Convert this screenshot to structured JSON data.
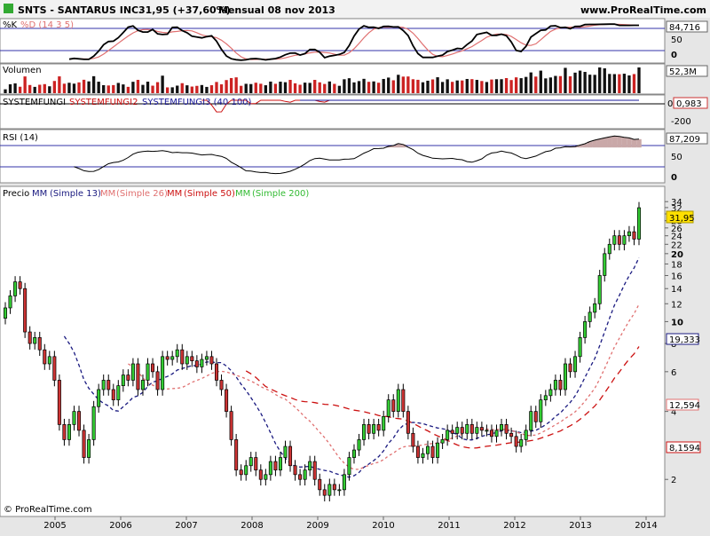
{
  "header": {
    "title": "SNTS - SANTARUS INC.",
    "last": "31,95 (+37,60%)",
    "period": "Mensual  08 nov 2013",
    "brand": "www.ProRealTime.com"
  },
  "footer": {
    "copyright": "© ProRealTime.com"
  },
  "colors": {
    "bg": "#e6e6e6",
    "panel": "#ffffff",
    "up": "#33cc33",
    "down": "#cc3333",
    "sma13": "#1a1a80",
    "sma26": "#e07070",
    "sma50": "#cc1111",
    "sma200": "#33bb33",
    "volume_up": "#111111",
    "volume_down": "#cc2222",
    "rsi_fill": "#c9a8a8",
    "last_label": "#ffe000"
  },
  "panels": {
    "stoch": {
      "label_k": "%K",
      "label_d": "%D (14 3 5)",
      "axis": [
        "50",
        "0"
      ],
      "last": "84,716"
    },
    "volume": {
      "label": "Volumen",
      "last": "52,3M"
    },
    "systemfungi": {
      "label1": "SYSTEMFUNGI",
      "label2": "SYSTEMFUNGI2",
      "label3": "SYSTEMFUNGI3 (40 100)",
      "axis": [
        "0",
        "-200"
      ],
      "last": "0,983"
    },
    "rsi": {
      "label": "RSI (14)",
      "axis": [
        "50",
        "0"
      ],
      "last": "87,209"
    },
    "price": {
      "label": "Precio",
      "ma_prefix": "MM",
      "ma13": "(Simple 13)",
      "ma26": "(Simple 26)",
      "ma50": "(Simple 50)",
      "ma200": "(Simple 200)",
      "axis_ticks": [
        "34",
        "32",
        "30",
        "28",
        "26",
        "24",
        "22",
        "20",
        "18",
        "16",
        "14",
        "12",
        "10",
        "8",
        "6",
        "4",
        "2"
      ],
      "last_labels": {
        "price": "31,95",
        "sma13": "19,333",
        "sma26": "12,594",
        "sma50": "8,1594"
      }
    }
  },
  "chart_data": {
    "type": "candlestick",
    "x_axis_labels": [
      "2005",
      "2006",
      "2007",
      "2008",
      "2009",
      "2010",
      "2011",
      "2012",
      "2013",
      "2014"
    ],
    "price_range": [
      1.5,
      35
    ],
    "price_scale": "log",
    "candles_close": [
      11.5,
      13,
      15,
      14,
      9,
      8,
      8.5,
      7.5,
      6.5,
      7,
      5.5,
      3.5,
      3,
      3.5,
      4,
      3.3,
      2.5,
      3,
      4.2,
      5,
      5.5,
      5,
      4.5,
      5.2,
      5.8,
      5.5,
      6.5,
      5,
      5.5,
      6.5,
      6,
      5,
      7,
      6.8,
      7,
      7.5,
      6.5,
      7,
      6.7,
      6.3,
      6.8,
      7,
      6.5,
      5.5,
      5,
      4,
      3,
      2.2,
      2.1,
      2.3,
      2.5,
      2.2,
      2,
      2.1,
      2.4,
      2.2,
      2.5,
      2.8,
      2.3,
      2.1,
      2,
      2.2,
      2.4,
      2,
      1.8,
      1.7,
      1.9,
      1.8,
      1.8,
      2.1,
      2.5,
      2.7,
      3,
      3.5,
      3.2,
      3.5,
      3.3,
      3.8,
      4.5,
      4,
      5,
      4,
      3.2,
      2.8,
      2.5,
      2.6,
      2.8,
      2.5,
      2.9,
      3,
      3.3,
      3.2,
      3.4,
      3.2,
      3.5,
      3.2,
      3.4,
      3.3,
      3.3,
      3.1,
      3.3,
      3.5,
      3.2,
      3.1,
      2.8,
      3,
      3.3,
      4,
      3.6,
      4.5,
      4.7,
      5,
      5.5,
      5,
      6.5,
      6,
      7,
      8.5,
      10,
      11,
      12,
      16,
      20,
      22,
      24,
      22,
      24,
      25,
      23.2,
      31.95
    ],
    "series": [
      {
        "name": "Simple 13",
        "last": 19.333
      },
      {
        "name": "Simple 26",
        "last": 12.594
      },
      {
        "name": "Simple 50",
        "last": 8.1594
      },
      {
        "name": "Simple 200"
      }
    ],
    "stoch_k_last": 84.716,
    "rsi_last": 87.209,
    "volume_last_millions": 52.3,
    "systemfungi_last": 0.983
  }
}
